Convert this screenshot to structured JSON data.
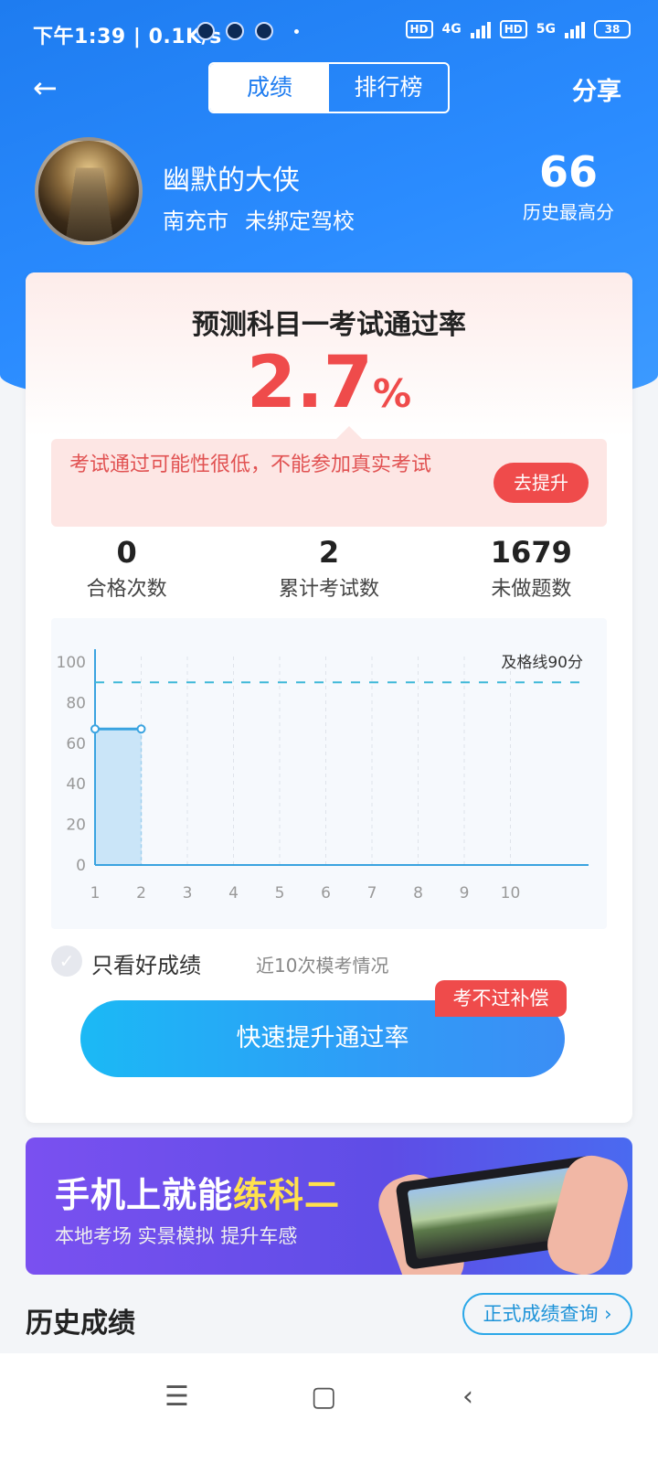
{
  "status": {
    "time": "下午1:39 | 0.1K/s",
    "net1": "4G",
    "net2": "5G",
    "hd": "HD",
    "battery": "38"
  },
  "nav": {
    "tabs": [
      "成绩",
      "排行榜"
    ],
    "active_tab": "成绩",
    "share": "分享"
  },
  "profile": {
    "name": "幽默的大侠",
    "city": "南充市",
    "school": "未绑定驾校",
    "best_score": "66",
    "best_label": "历史最高分"
  },
  "prediction": {
    "title": "预测科目一考试通过率",
    "rate_value": "2.7",
    "rate_unit": "%",
    "warning": "考试通过可能性很低，不能参加真实考试",
    "improve_button": "去提升"
  },
  "stats": [
    {
      "value": "0",
      "label": "合格次数"
    },
    {
      "value": "2",
      "label": "累计考试数"
    },
    {
      "value": "1679",
      "label": "未做题数"
    }
  ],
  "chart_data": {
    "type": "area",
    "x": [
      1,
      2
    ],
    "values": [
      67,
      67
    ],
    "xticks": [
      "1",
      "2",
      "3",
      "4",
      "5",
      "6",
      "7",
      "8",
      "9",
      "10"
    ],
    "yticks": [
      "0",
      "20",
      "40",
      "60",
      "80",
      "100"
    ],
    "ylim": [
      0,
      100
    ],
    "pass_line": 90,
    "pass_label": "及格线90分",
    "grid": true,
    "colors": {
      "line": "#3aa3e0",
      "fill": "#bfe0f6",
      "pass": "#3fb8d8"
    }
  },
  "filter": {
    "only_good": "只看好成绩",
    "recent": "近10次模考情况"
  },
  "cta": {
    "badge": "考不过补偿",
    "label": "快速提升通过率"
  },
  "banner": {
    "title_main": "手机上就能",
    "title_highlight": "练科二",
    "subtitle": "本地考场 实景模拟 提升车感"
  },
  "history": {
    "title": "历史成绩",
    "query_button": "正式成绩查询 ›"
  },
  "system_nav": {
    "menu": "☰",
    "home": "▢",
    "back": "‹"
  }
}
